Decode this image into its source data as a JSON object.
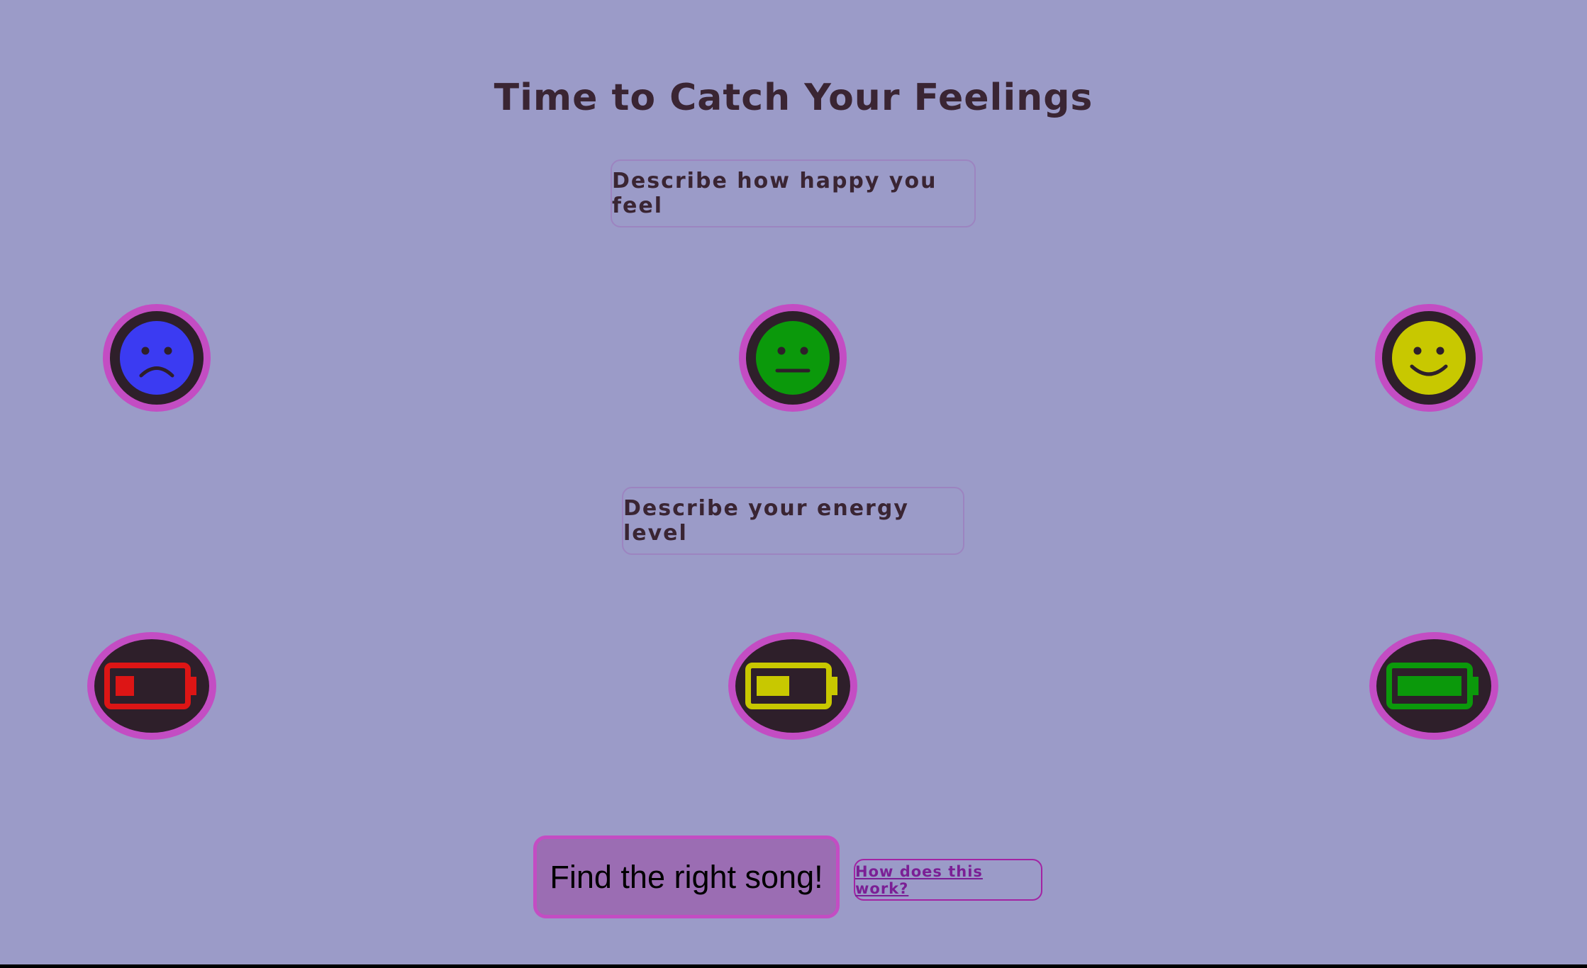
{
  "page": {
    "title": "Time to Catch Your Feelings"
  },
  "happiness": {
    "prompt": "Describe how happy you feel",
    "options": [
      {
        "name": "sad",
        "icon": "sad-face-icon",
        "color": "#3b3bf2"
      },
      {
        "name": "neutral",
        "icon": "neutral-face-icon",
        "color": "#0b990b"
      },
      {
        "name": "happy",
        "icon": "smiling-face-icon",
        "color": "#c8c800"
      }
    ]
  },
  "energy": {
    "prompt": "Describe your energy level",
    "options": [
      {
        "name": "low",
        "icon": "battery-low-icon",
        "color": "#dd1515",
        "fill": 0.2
      },
      {
        "name": "medium",
        "icon": "battery-half-icon",
        "color": "#c8c800",
        "fill": 0.45
      },
      {
        "name": "high",
        "icon": "battery-full-icon",
        "color": "#0b990b",
        "fill": 1.0
      }
    ]
  },
  "actions": {
    "find_label": "Find the right song!",
    "how_label": "How does this work?"
  },
  "colors": {
    "background": "#9b9bc8",
    "accent_border": "#c34dc3",
    "icon_backing": "#2e1f2a",
    "text": "#3a2533"
  }
}
